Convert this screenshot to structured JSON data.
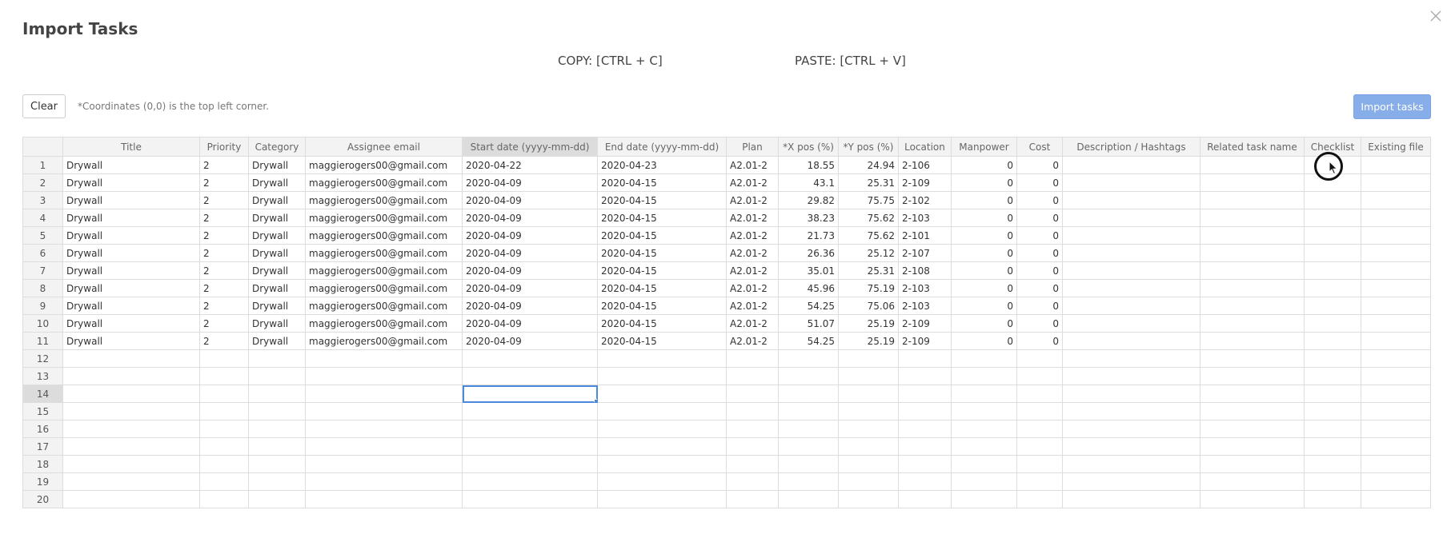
{
  "modal": {
    "title": "Import Tasks",
    "copy_hint": "COPY: [CTRL + C]",
    "paste_hint": "PASTE: [CTRL + V]",
    "clear_label": "Clear",
    "coords_note": "*Coordinates (0,0) is the top left corner.",
    "import_label": "Import tasks",
    "close_icon": "close-icon"
  },
  "colors": {
    "import_button": "#88aeea",
    "selection": "#4b89dc",
    "header_bg": "#f3f3f3",
    "active_header_bg": "#dcdcdc"
  },
  "table": {
    "columns": [
      "Title",
      "Priority",
      "Category",
      "Assignee email",
      "Start date (yyyy-mm-dd)",
      "End date (yyyy-mm-dd)",
      "Plan",
      "*X pos (%)",
      "*Y pos (%)",
      "Location",
      "Manpower",
      "Cost",
      "Description / Hashtags",
      "Related task name",
      "Checklist",
      "Existing file"
    ],
    "active_column": "Start date (yyyy-mm-dd)",
    "active_row": "14",
    "selected_cell": {
      "row": "14",
      "column": "Start date (yyyy-mm-dd)"
    },
    "rows": [
      {
        "num": "1",
        "cells": [
          "Drywall",
          "2",
          "Drywall",
          "maggierogers00@gmail.com",
          "2020-04-22",
          "2020-04-23",
          "A2.01-2",
          "18.55",
          "24.94",
          "2-106",
          "0",
          "0",
          "",
          "",
          "",
          ""
        ]
      },
      {
        "num": "2",
        "cells": [
          "Drywall",
          "2",
          "Drywall",
          "maggierogers00@gmail.com",
          "2020-04-09",
          "2020-04-15",
          "A2.01-2",
          "43.1",
          "25.31",
          "2-109",
          "0",
          "0",
          "",
          "",
          "",
          ""
        ]
      },
      {
        "num": "3",
        "cells": [
          "Drywall",
          "2",
          "Drywall",
          "maggierogers00@gmail.com",
          "2020-04-09",
          "2020-04-15",
          "A2.01-2",
          "29.82",
          "75.75",
          "2-102",
          "0",
          "0",
          "",
          "",
          "",
          ""
        ]
      },
      {
        "num": "4",
        "cells": [
          "Drywall",
          "2",
          "Drywall",
          "maggierogers00@gmail.com",
          "2020-04-09",
          "2020-04-15",
          "A2.01-2",
          "38.23",
          "75.62",
          "2-103",
          "0",
          "0",
          "",
          "",
          "",
          ""
        ]
      },
      {
        "num": "5",
        "cells": [
          "Drywall",
          "2",
          "Drywall",
          "maggierogers00@gmail.com",
          "2020-04-09",
          "2020-04-15",
          "A2.01-2",
          "21.73",
          "75.62",
          "2-101",
          "0",
          "0",
          "",
          "",
          "",
          ""
        ]
      },
      {
        "num": "6",
        "cells": [
          "Drywall",
          "2",
          "Drywall",
          "maggierogers00@gmail.com",
          "2020-04-09",
          "2020-04-15",
          "A2.01-2",
          "26.36",
          "25.12",
          "2-107",
          "0",
          "0",
          "",
          "",
          "",
          ""
        ]
      },
      {
        "num": "7",
        "cells": [
          "Drywall",
          "2",
          "Drywall",
          "maggierogers00@gmail.com",
          "2020-04-09",
          "2020-04-15",
          "A2.01-2",
          "35.01",
          "25.31",
          "2-108",
          "0",
          "0",
          "",
          "",
          "",
          ""
        ]
      },
      {
        "num": "8",
        "cells": [
          "Drywall",
          "2",
          "Drywall",
          "maggierogers00@gmail.com",
          "2020-04-09",
          "2020-04-15",
          "A2.01-2",
          "45.96",
          "75.19",
          "2-103",
          "0",
          "0",
          "",
          "",
          "",
          ""
        ]
      },
      {
        "num": "9",
        "cells": [
          "Drywall",
          "2",
          "Drywall",
          "maggierogers00@gmail.com",
          "2020-04-09",
          "2020-04-15",
          "A2.01-2",
          "54.25",
          "75.06",
          "2-103",
          "0",
          "0",
          "",
          "",
          "",
          ""
        ]
      },
      {
        "num": "10",
        "cells": [
          "Drywall",
          "2",
          "Drywall",
          "maggierogers00@gmail.com",
          "2020-04-09",
          "2020-04-15",
          "A2.01-2",
          "51.07",
          "25.19",
          "2-109",
          "0",
          "0",
          "",
          "",
          "",
          ""
        ]
      },
      {
        "num": "11",
        "cells": [
          "Drywall",
          "2",
          "Drywall",
          "maggierogers00@gmail.com",
          "2020-04-09",
          "2020-04-15",
          "A2.01-2",
          "54.25",
          "25.19",
          "2-109",
          "0",
          "0",
          "",
          "",
          "",
          ""
        ]
      },
      {
        "num": "12",
        "cells": [
          "",
          "",
          "",
          "",
          "",
          "",
          "",
          "",
          "",
          "",
          "",
          "",
          "",
          "",
          "",
          ""
        ]
      },
      {
        "num": "13",
        "cells": [
          "",
          "",
          "",
          "",
          "",
          "",
          "",
          "",
          "",
          "",
          "",
          "",
          "",
          "",
          "",
          ""
        ]
      },
      {
        "num": "14",
        "cells": [
          "",
          "",
          "",
          "",
          "",
          "",
          "",
          "",
          "",
          "",
          "",
          "",
          "",
          "",
          "",
          ""
        ]
      },
      {
        "num": "15",
        "cells": [
          "",
          "",
          "",
          "",
          "",
          "",
          "",
          "",
          "",
          "",
          "",
          "",
          "",
          "",
          "",
          ""
        ]
      },
      {
        "num": "16",
        "cells": [
          "",
          "",
          "",
          "",
          "",
          "",
          "",
          "",
          "",
          "",
          "",
          "",
          "",
          "",
          "",
          ""
        ]
      },
      {
        "num": "17",
        "cells": [
          "",
          "",
          "",
          "",
          "",
          "",
          "",
          "",
          "",
          "",
          "",
          "",
          "",
          "",
          "",
          ""
        ]
      },
      {
        "num": "18",
        "cells": [
          "",
          "",
          "",
          "",
          "",
          "",
          "",
          "",
          "",
          "",
          "",
          "",
          "",
          "",
          "",
          ""
        ]
      },
      {
        "num": "19",
        "cells": [
          "",
          "",
          "",
          "",
          "",
          "",
          "",
          "",
          "",
          "",
          "",
          "",
          "",
          "",
          "",
          ""
        ]
      },
      {
        "num": "20",
        "cells": [
          "",
          "",
          "",
          "",
          "",
          "",
          "",
          "",
          "",
          "",
          "",
          "",
          "",
          "",
          "",
          ""
        ]
      }
    ]
  }
}
